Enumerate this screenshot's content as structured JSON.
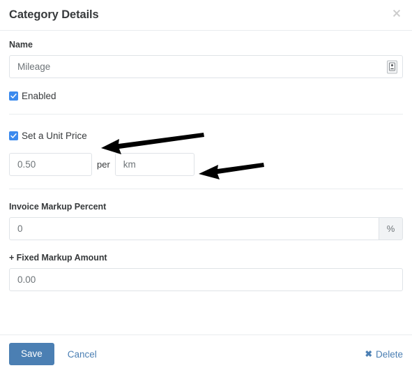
{
  "dialog": {
    "title": "Category Details",
    "close_icon": "close-icon"
  },
  "form": {
    "name": {
      "label": "Name",
      "value": "Mileage",
      "placeholder": "Mileage",
      "trailing_icon": "autofill-card-icon"
    },
    "enabled": {
      "label": "Enabled",
      "checked": true
    },
    "set_unit_price": {
      "label": "Set a Unit Price",
      "checked": true
    },
    "unit_price": {
      "value": "0.50",
      "placeholder": "0.50"
    },
    "per_label": "per",
    "unit": {
      "value": "km",
      "placeholder": "km"
    },
    "invoice_markup_percent": {
      "label": "Invoice Markup Percent",
      "value": "0",
      "placeholder": "0",
      "addon": "%"
    },
    "fixed_markup_amount": {
      "label": "+ Fixed Markup Amount",
      "value": "0.00",
      "placeholder": "0.00"
    }
  },
  "footer": {
    "save_label": "Save",
    "cancel_label": "Cancel",
    "delete_label": "Delete",
    "delete_icon": "x-mark-icon"
  },
  "annotations": [
    {
      "name": "arrow-to-set-unit-price-checkbox",
      "target": "Set a Unit Price checkbox"
    },
    {
      "name": "arrow-to-unit-field",
      "target": "unit (km) input"
    }
  ],
  "colors": {
    "accent_blue": "#4b7fb3",
    "checkbox_blue": "#3b8aee",
    "text": "#373a3c",
    "muted_text": "#6e7478",
    "border": "#dfe3e7",
    "divider": "#e9ecef",
    "addon_bg": "#f1f3f5",
    "annotation": "#000000"
  }
}
